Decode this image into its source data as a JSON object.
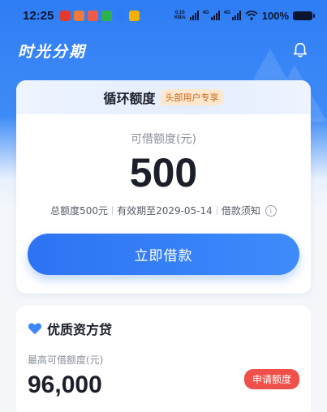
{
  "status_bar": {
    "time": "12:25",
    "net_speed_value": "0.10",
    "net_speed_unit": "KB/s",
    "network_1": "4G",
    "network_2": "4G",
    "battery": "100%"
  },
  "header": {
    "app_title": "时光分期"
  },
  "credit_card": {
    "title": "循环额度",
    "tag": "头部用户专享",
    "available_label": "可借额度(元)",
    "available_amount": "500",
    "total_limit": "总额度500元",
    "valid_until": "有效期至2029-05-14",
    "borrow_notice": "借款须知",
    "borrow_button": "立即借款"
  },
  "quality_loan": {
    "title": "优质资方贷",
    "max_label": "最高可借额度(元)",
    "max_amount": "96,000",
    "apply_button": "申请额度"
  },
  "colors": {
    "primary_blue": "#2f7df4",
    "apply_red": "#f0504a",
    "tag_orange": "#c46a1d"
  }
}
